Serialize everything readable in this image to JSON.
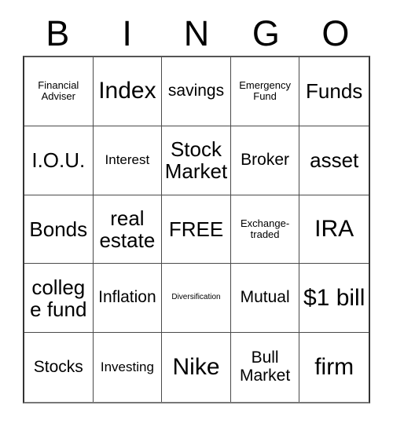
{
  "card": {
    "title": "BINGO",
    "header_letters": [
      "B",
      "I",
      "N",
      "G",
      "O"
    ],
    "free_space_label": "FREE",
    "rows": [
      [
        {
          "label": "Financial Adviser",
          "size": "xs"
        },
        {
          "label": "Index",
          "size": "xl"
        },
        {
          "label": "savings",
          "size": "md"
        },
        {
          "label": "Emergency Fund",
          "size": "xs"
        },
        {
          "label": "Funds",
          "size": "lg"
        }
      ],
      [
        {
          "label": "I.O.U.",
          "size": "lg"
        },
        {
          "label": "Interest",
          "size": "sm"
        },
        {
          "label": "Stock Market",
          "size": "lg"
        },
        {
          "label": "Broker",
          "size": "md"
        },
        {
          "label": "asset",
          "size": "lg"
        }
      ],
      [
        {
          "label": "Bonds",
          "size": "lg"
        },
        {
          "label": "real estate",
          "size": "lg"
        },
        {
          "label": "FREE",
          "size": "lg"
        },
        {
          "label": "Exchange-traded",
          "size": "xs"
        },
        {
          "label": "IRA",
          "size": "xl"
        }
      ],
      [
        {
          "label": "college fund",
          "size": "lg"
        },
        {
          "label": "Inflation",
          "size": "md"
        },
        {
          "label": "Diversification",
          "size": "xxs"
        },
        {
          "label": "Mutual",
          "size": "md"
        },
        {
          "label": "$1 bill",
          "size": "xl"
        }
      ],
      [
        {
          "label": "Stocks",
          "size": "md"
        },
        {
          "label": "Investing",
          "size": "sm"
        },
        {
          "label": "Nike",
          "size": "xl"
        },
        {
          "label": "Bull Market",
          "size": "md"
        },
        {
          "label": "firm",
          "size": "xl"
        }
      ]
    ]
  },
  "colors": {
    "grid_line": "#4a4a4a",
    "grid_border": "#333333",
    "text": "#000000",
    "background": "#ffffff"
  }
}
